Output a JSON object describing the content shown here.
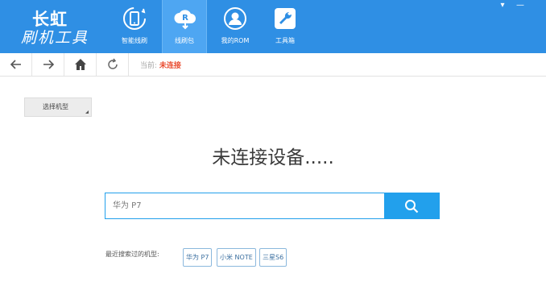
{
  "app": {
    "logo_line1": "长虹",
    "logo_line2": "刷机工具"
  },
  "nav": [
    {
      "label": "智能线刷",
      "icon": "phone-refresh-icon"
    },
    {
      "label": "线刷包",
      "icon": "rom-download-icon"
    },
    {
      "label": "我的ROM",
      "icon": "user-icon"
    },
    {
      "label": "工具箱",
      "icon": "wrench-icon"
    }
  ],
  "window": {
    "menu_glyph": "▾",
    "minimize_glyph": "—"
  },
  "toolbar": {
    "status_label": "当前: ",
    "status_value": "未连接"
  },
  "model_select": {
    "label": "选择机型"
  },
  "headline": "未连接设备.....",
  "search": {
    "placeholder": "华为 P7"
  },
  "recent": {
    "label": "最近搜索过的机型:",
    "tags": [
      "华为 P7",
      "小米 NOTE",
      "三星S6"
    ]
  },
  "colors": {
    "header": "#2f8fe4",
    "accent": "#22a0ec",
    "status": "#e94b2f"
  }
}
